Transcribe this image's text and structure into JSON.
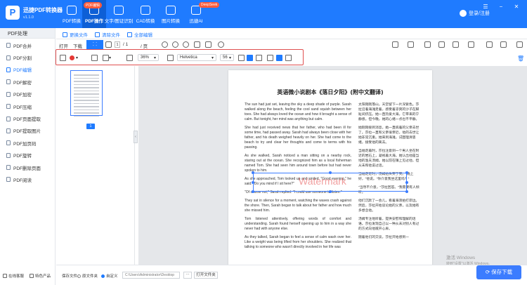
{
  "app": {
    "name": "迅捷PDF转换器",
    "version": "v1.1.0",
    "logo": "P"
  },
  "nav": {
    "tabs": [
      {
        "label": "PDF转换",
        "icon": "pdf-convert-icon"
      },
      {
        "label": "PDF操作",
        "icon": "pdf-operate-icon",
        "badge": "PDF编辑",
        "active": true
      },
      {
        "label": "文字/图证识别",
        "icon": "ocr-icon"
      },
      {
        "label": "CAD转换",
        "icon": "cad-icon"
      },
      {
        "label": "图片转换",
        "icon": "image-icon"
      },
      {
        "label": "迅捷AI",
        "icon": "ai-icon",
        "badge": "DeepSeek"
      }
    ],
    "login": "登录/注册"
  },
  "sidebar": {
    "header": "PDF处理",
    "items": [
      {
        "label": "PDF合并"
      },
      {
        "label": "PDF分割"
      },
      {
        "label": "PDF编辑",
        "active": true
      },
      {
        "label": "PDF解密"
      },
      {
        "label": "PDF加密"
      },
      {
        "label": "PDF压缩"
      },
      {
        "label": "PDF页面提取"
      },
      {
        "label": "PDF提取图片"
      },
      {
        "label": "PDF加页码"
      },
      {
        "label": "PDF旋转"
      },
      {
        "label": "PDF删除页面"
      },
      {
        "label": "PDF阅读"
      }
    ],
    "footer": {
      "left": "在线客服",
      "right": "特色产品"
    }
  },
  "subbar": {
    "change_file": "更换文件",
    "clear_file": "清除文件",
    "full_edit": "全部编辑"
  },
  "toolbar": {
    "open": "打开",
    "download": "下载",
    "page_sep": "/ 1",
    "page_total": "/ 页",
    "page_value": "1"
  },
  "edit_toolbar": {
    "zoom": "36%",
    "font": "Helvetica",
    "font_size": "56"
  },
  "document": {
    "title": "英语微小说剧本《落日夕阳》(附中文翻译)",
    "watermark": "Watermark",
    "left_paragraphs": [
      "The sun had just set, leaving the sky a deep shade of purple. Sarah walked along the beach, feeling the cool sand squish between her toes. She had always loved the ocean and how it brought a sense of calm. But tonight, her mind was anything but calm.",
      "She had just received news that her father, who had been ill for some time, had passed away. Sarah had always been close with her father, and his death weighed heavily on her. She had come to the beach to try and clear her thoughts and come to terms with his passing.",
      "As she walked, Sarah noticed a man sitting on a nearby rock, staring out at the ocean. She recognized him as a local fisherman named Tom. She had seen him around town before but had never spoken to him.",
      "As she approached, Tom looked up and smiled. \"Good evening,\" he said. \"Do you mind if I sit here?\"",
      "\"Of course not,\" Sarah replied. \"I could use someone to listen.\"",
      "They sat in silence for a moment, watching the waves crash against the shore. Then, Sarah began to talk about her father and how much she missed him.",
      "Tom listened attentively, offering words of comfort and understanding. Sarah found herself opening up to him in a way she never had with anyone else.",
      "As they talked, Sarah began to feel a sense of calm wash over her. Like a weight was being lifted from her shoulders. She realized that talking to someone who wasn't directly involved in her life was"
    ],
    "right_paragraphs": [
      "太阳刚刚落山，天空留下一片深紫色。莎拉沿着海滩走着，感受着凉爽的沙子在脚趾间挤压。她一直热爱大海，它带来的宁静感。但今晚，她的心绪一点也不平静。",
      "她刚刚接到消息，她一直病着的父亲去世了。莎拉一直和父亲很亲近，他的去世让她非常沉重。她来到海滩，试图理清思绪，接受他的离去。",
      "当她走着时，莎拉注意到一个男人坐在附近的岩石上，凝视着大海。她认出他是当地的渔夫汤姆。她以前在镇上见过他，但从未和他说过话。",
      "当她走近时，汤姆抬头笑了笑。\"晚上好，\"他说。\"你介意我坐这里吗？\"",
      "\"当然不介意，\"莎拉回答。\"我需要有人倾听。\"",
      "他们沉默了一会儿，看着海浪拍打岸边。然后，莎拉开始谈论她的父亲，以及她有多想念他。",
      "汤姆专注地听着，提供安慰和理解的话语。莎拉发现自己以一种从未对别人有过的方式向他敞开心扉。",
      "随着他们的交谈，莎拉开始感到一"
    ]
  },
  "thumbnail": {
    "page_num": "1"
  },
  "windows_notice": {
    "line1": "激活 Windows",
    "line2": "转到\"设置\"以激活 Windows。"
  },
  "bottom": {
    "save_label": "保存文件：",
    "option_original": "原文件夹",
    "option_custom": "自定义",
    "path": "C:\\Users\\Administrator\\Desktop",
    "dots": "···",
    "open_folder": "打开文件夹",
    "save_button": "保存下载"
  }
}
